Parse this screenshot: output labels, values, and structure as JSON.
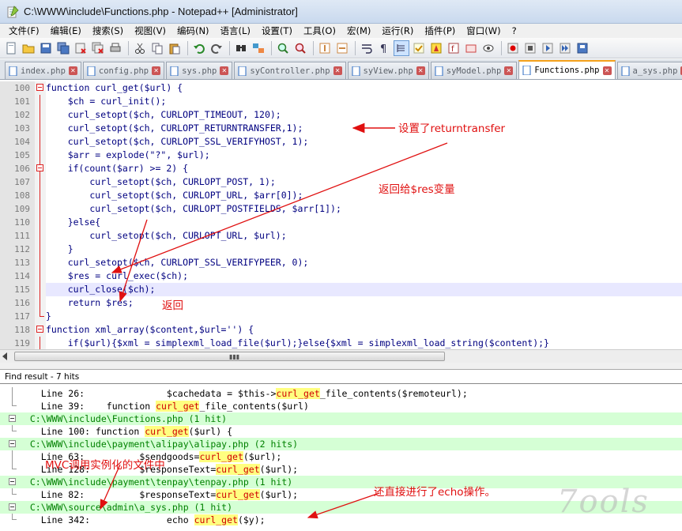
{
  "window": {
    "title": "C:\\WWW\\include\\Functions.php - Notepad++ [Administrator]"
  },
  "menu": [
    "文件(F)",
    "编辑(E)",
    "搜索(S)",
    "视图(V)",
    "编码(N)",
    "语言(L)",
    "设置(T)",
    "工具(O)",
    "宏(M)",
    "运行(R)",
    "插件(P)",
    "窗口(W)",
    "?"
  ],
  "tabs": [
    {
      "label": "index.php",
      "active": false
    },
    {
      "label": "config.php",
      "active": false
    },
    {
      "label": "sys.php",
      "active": false
    },
    {
      "label": "syController.php",
      "active": false
    },
    {
      "label": "syView.php",
      "active": false
    },
    {
      "label": "syModel.php",
      "active": false
    },
    {
      "label": "Functions.php",
      "active": true
    },
    {
      "label": "a_sys.php",
      "active": false
    }
  ],
  "code_lines": [
    {
      "num": "100",
      "text": "function curl_get($url) {",
      "fold": "start"
    },
    {
      "num": "101",
      "text": "    $ch = curl_init();",
      "fold": "line"
    },
    {
      "num": "102",
      "text": "    curl_setopt($ch, CURLOPT_TIMEOUT, 120);",
      "fold": "line"
    },
    {
      "num": "103",
      "text": "    curl_setopt($ch, CURLOPT_RETURNTRANSFER,1);",
      "fold": "line"
    },
    {
      "num": "104",
      "text": "    curl_setopt($ch, CURLOPT_SSL_VERIFYHOST, 1);",
      "fold": "line"
    },
    {
      "num": "105",
      "text": "    $arr = explode(\"?\", $url);",
      "fold": "line"
    },
    {
      "num": "106",
      "text": "    if(count($arr) >= 2) {",
      "fold": "start"
    },
    {
      "num": "107",
      "text": "        curl_setopt($ch, CURLOPT_POST, 1);",
      "fold": "line"
    },
    {
      "num": "108",
      "text": "        curl_setopt($ch, CURLOPT_URL, $arr[0]);",
      "fold": "line"
    },
    {
      "num": "109",
      "text": "        curl_setopt($ch, CURLOPT_POSTFIELDS, $arr[1]);",
      "fold": "line"
    },
    {
      "num": "110",
      "text": "    }else{",
      "fold": "line"
    },
    {
      "num": "111",
      "text": "        curl_setopt($ch, CURLOPT_URL, $url);",
      "fold": "line"
    },
    {
      "num": "112",
      "text": "    }",
      "fold": "end"
    },
    {
      "num": "113",
      "text": "    curl_setopt($ch, CURLOPT_SSL_VERIFYPEER, 0);",
      "fold": "line"
    },
    {
      "num": "114",
      "text": "    $res = curl_exec($ch);",
      "fold": "line"
    },
    {
      "num": "115",
      "text": "    curl_close($ch);",
      "fold": "line",
      "highlight": true
    },
    {
      "num": "116",
      "text": "    return $res;",
      "fold": "line"
    },
    {
      "num": "117",
      "text": "}",
      "fold": "end"
    },
    {
      "num": "118",
      "text": "function xml_array($content,$url='') {",
      "fold": "start"
    },
    {
      "num": "119",
      "text": "    if($url){$xml = simplexml_load_file($url);}else{$xml = simplexml_load_string($content);}",
      "fold": "line"
    }
  ],
  "find_result": {
    "header": "Find result - 7 hits",
    "lines": [
      {
        "type": "hit",
        "fold": "line",
        "prefix": "    Line 26:               $cachedata = $this->",
        "match": "curl_get",
        "suffix": "_file_contents($remoteurl);"
      },
      {
        "type": "hit",
        "fold": "end",
        "prefix": "    Line 39:    function ",
        "match": "curl_get",
        "suffix": "_file_contents($url)"
      },
      {
        "type": "file",
        "fold": "box",
        "prefix": "  C:\\WWW\\include\\Functions.php (1 hit)",
        "match": "",
        "suffix": ""
      },
      {
        "type": "hit",
        "fold": "end",
        "prefix": "    Line 100: function ",
        "match": "curl_get",
        "suffix": "($url) {"
      },
      {
        "type": "file",
        "fold": "box",
        "prefix": "  C:\\WWW\\include\\payment\\alipay\\alipay.php (2 hits)",
        "match": "",
        "suffix": ""
      },
      {
        "type": "hit",
        "fold": "line",
        "prefix": "    Line 63:          $sendgoods=",
        "match": "curl_get",
        "suffix": "($url);"
      },
      {
        "type": "hit",
        "fold": "end",
        "prefix": "    Line 128:         $responseText=",
        "match": "curl_get",
        "suffix": "($url);"
      },
      {
        "type": "file",
        "fold": "box",
        "prefix": "  C:\\WWW\\include\\payment\\tenpay\\tenpay.php (1 hit)",
        "match": "",
        "suffix": ""
      },
      {
        "type": "hit",
        "fold": "end",
        "prefix": "    Line 82:          $responseText=",
        "match": "curl_get",
        "suffix": "($url);"
      },
      {
        "type": "file",
        "fold": "box",
        "prefix": "  C:\\WWW\\source\\admin\\a_sys.php (1 hit)",
        "match": "",
        "suffix": ""
      },
      {
        "type": "hit",
        "fold": "end",
        "prefix": "    Line 342:              echo ",
        "match": "curl_get",
        "suffix": "($y);"
      }
    ]
  },
  "annotations": {
    "returntransfer": "设置了returntransfer",
    "return_res": "返回给$res变量",
    "return": "返回",
    "mvc": "MVC调用实例化的文件中",
    "echo": "还直接进行了echo操作。"
  },
  "watermark": "7ools"
}
